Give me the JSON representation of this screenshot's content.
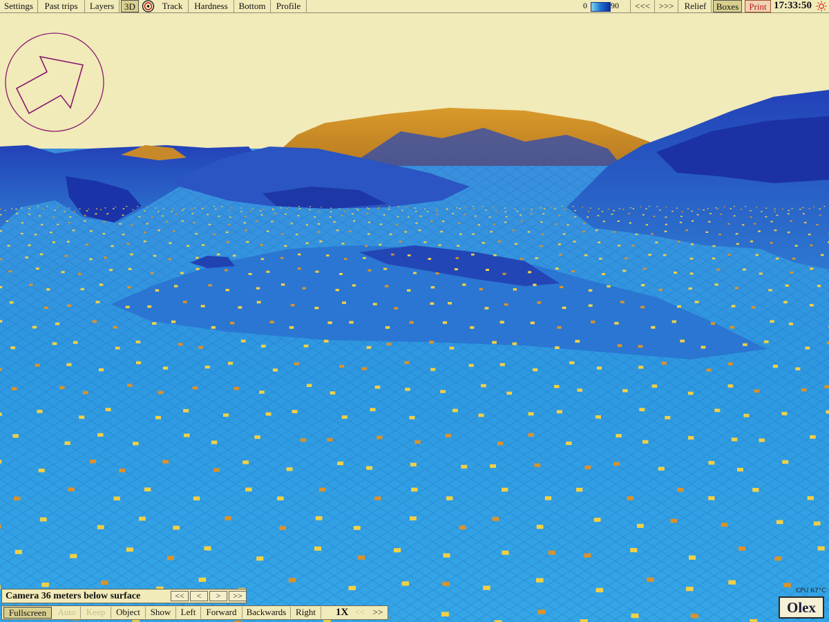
{
  "toolbar": {
    "items": [
      {
        "label": "Settings"
      },
      {
        "label": "Past trips"
      },
      {
        "label": "Layers"
      },
      {
        "label": "3D"
      },
      {
        "label": "Track"
      },
      {
        "label": "Hardness"
      },
      {
        "label": "Bottom"
      },
      {
        "label": "Profile"
      }
    ],
    "scale_min": "0",
    "scale_max": "90",
    "prev_label": "<<<",
    "next_label": ">>>",
    "relief_label": "Relief",
    "boxes_label": "Boxes",
    "print_label": "Print",
    "clock": "17:33:50"
  },
  "colors": {
    "sky": "#f1eab9",
    "shallow": "#2f9ee2",
    "deep": "#1a3fb8",
    "peak": "#cf8f24",
    "marker": "#f2d046",
    "compass": "#8a1a6e",
    "print": "#c0141c"
  },
  "compass": {
    "icon": "direction-arrow-icon"
  },
  "camera": {
    "status": "Camera 36 meters below surface",
    "buttons": [
      "<<",
      "<",
      ">",
      ">>"
    ]
  },
  "controls": {
    "fullscreen": "Fullscreen",
    "auto": "Auto",
    "keep": "Keep",
    "object": "Object",
    "show": "Show",
    "left": "Left",
    "forward": "Forward",
    "backwards": "Backwards",
    "right": "Right",
    "speed": "1X",
    "slower": "<<",
    "faster": ">>"
  },
  "cpu": "CPU 67°C",
  "brand": "Olex"
}
